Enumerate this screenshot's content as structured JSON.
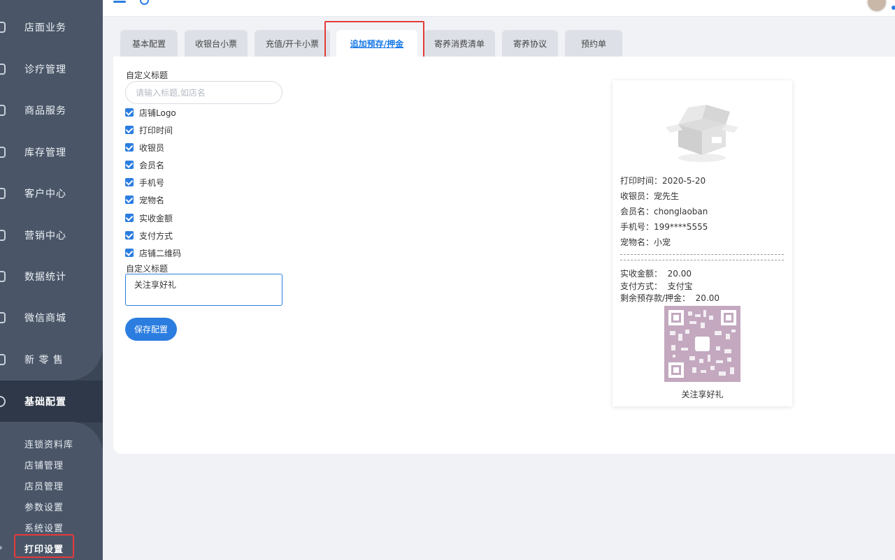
{
  "sidebar": {
    "items": [
      {
        "label": "店面业务",
        "icon": "store-icon"
      },
      {
        "label": "诊疗管理",
        "icon": "clinic-icon"
      },
      {
        "label": "商品服务",
        "icon": "goods-icon"
      },
      {
        "label": "库存管理",
        "icon": "inventory-icon"
      },
      {
        "label": "客户中心",
        "icon": "customer-icon"
      },
      {
        "label": "营销中心",
        "icon": "marketing-icon"
      },
      {
        "label": "数据统计",
        "icon": "stats-icon"
      },
      {
        "label": "微信商城",
        "icon": "wechat-mall-icon"
      },
      {
        "label": "新 零 售",
        "icon": "retail-icon"
      },
      {
        "label": "基础配置",
        "icon": "settings-icon"
      }
    ],
    "subitems": [
      "连锁资料库",
      "店铺管理",
      "店员管理",
      "参数设置",
      "系统设置",
      "打印设置"
    ]
  },
  "tabs": [
    "基本配置",
    "收银台小票",
    "充值/开卡小票",
    "追加预存/押金",
    "寄养消费清单",
    "寄养协议",
    "预约单"
  ],
  "form": {
    "header_label": "自定义标题",
    "header_placeholder": "请输入标题,如店名",
    "options": [
      "店铺Logo",
      "打印时间",
      "收银员",
      "会员名",
      "手机号",
      "宠物名",
      "实收金额",
      "支付方式",
      "店铺二维码"
    ],
    "footer_label": "自定义标题",
    "footer_value": "关注享好礼",
    "save_label": "保存配置"
  },
  "receipt": {
    "lines": [
      "打印时间：2020-5-20",
      "收银员：宠先生",
      "会员名：chonglaoban",
      "手机号：199****5555",
      "宠物名：小宠"
    ],
    "amount_lines": [
      "实收金额：  20.00",
      "支付方式：  支付宝",
      "剩余预存款/押金：  20.00"
    ],
    "qr_caption": "关注享好礼"
  },
  "colors": {
    "accent": "#2b7de0",
    "highlight": "#e53a3a",
    "sidebar": "#3a4556"
  }
}
